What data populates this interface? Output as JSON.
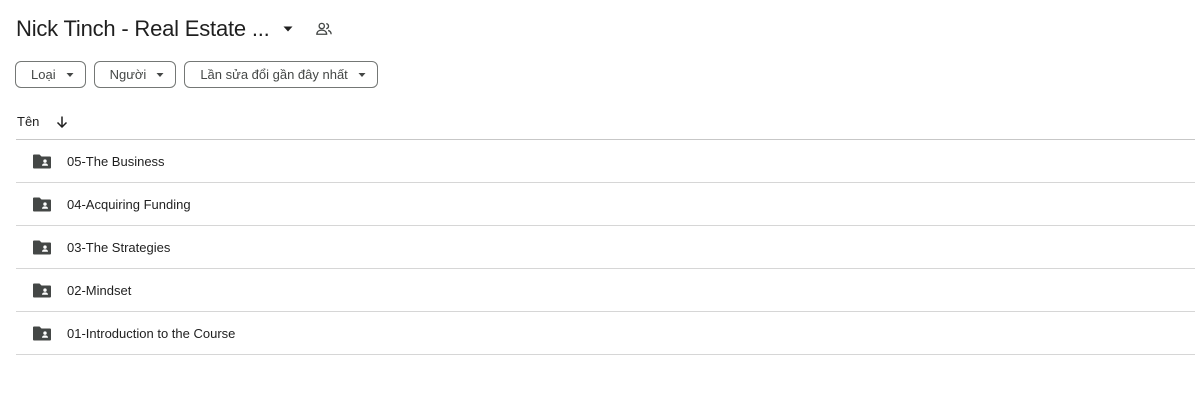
{
  "header": {
    "title": "Nick Tinch - Real Estate ...",
    "caret_icon": "arrow-drop-down-icon",
    "share_icon": "shared-people-icon"
  },
  "filters": [
    {
      "label": "Loại"
    },
    {
      "label": "Người"
    },
    {
      "label": "Lần sửa đổi gần đây nhất"
    }
  ],
  "list": {
    "name_column": "Tên",
    "sort_icon": "arrow-down-icon",
    "items": [
      {
        "name": "05-The Business",
        "icon": "shared-folder-icon"
      },
      {
        "name": "04-Acquiring Funding",
        "icon": "shared-folder-icon"
      },
      {
        "name": "03-The Strategies",
        "icon": "shared-folder-icon"
      },
      {
        "name": "02-Mindset",
        "icon": "shared-folder-icon"
      },
      {
        "name": "01-Introduction to the Course",
        "icon": "shared-folder-icon"
      }
    ]
  },
  "colors": {
    "text": "#1f1f1f",
    "icon": "#444746",
    "divider": "#c7c7c7"
  }
}
